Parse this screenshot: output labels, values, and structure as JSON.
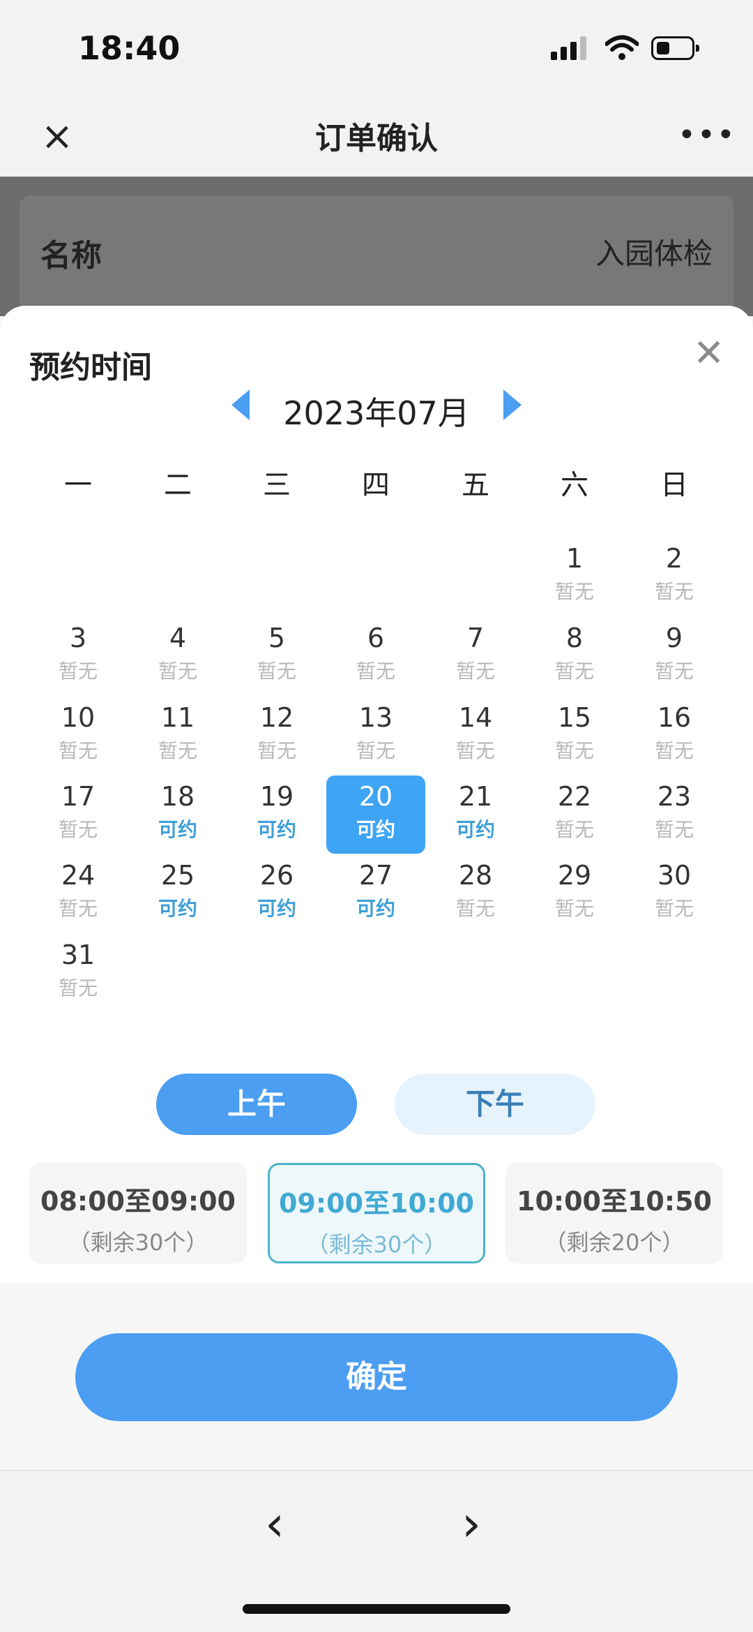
{
  "status": {
    "time": "18:40"
  },
  "header": {
    "title": "订单确认"
  },
  "background": {
    "name_label": "名称",
    "name_value": "入园体检"
  },
  "sheet": {
    "title": "预约时间",
    "month": "2023年07月"
  },
  "weekdays": [
    "一",
    "二",
    "三",
    "四",
    "五",
    "六",
    "日"
  ],
  "days": [
    {
      "num": "1",
      "status": "暂无",
      "avail": false
    },
    {
      "num": "2",
      "status": "暂无",
      "avail": false
    },
    {
      "num": "3",
      "status": "暂无",
      "avail": false
    },
    {
      "num": "4",
      "status": "暂无",
      "avail": false
    },
    {
      "num": "5",
      "status": "暂无",
      "avail": false
    },
    {
      "num": "6",
      "status": "暂无",
      "avail": false
    },
    {
      "num": "7",
      "status": "暂无",
      "avail": false
    },
    {
      "num": "8",
      "status": "暂无",
      "avail": false
    },
    {
      "num": "9",
      "status": "暂无",
      "avail": false
    },
    {
      "num": "10",
      "status": "暂无",
      "avail": false
    },
    {
      "num": "11",
      "status": "暂无",
      "avail": false
    },
    {
      "num": "12",
      "status": "暂无",
      "avail": false
    },
    {
      "num": "13",
      "status": "暂无",
      "avail": false
    },
    {
      "num": "14",
      "status": "暂无",
      "avail": false
    },
    {
      "num": "15",
      "status": "暂无",
      "avail": false
    },
    {
      "num": "16",
      "status": "暂无",
      "avail": false
    },
    {
      "num": "17",
      "status": "暂无",
      "avail": false
    },
    {
      "num": "18",
      "status": "可约",
      "avail": true
    },
    {
      "num": "19",
      "status": "可约",
      "avail": true
    },
    {
      "num": "20",
      "status": "可约",
      "avail": true,
      "selected": true
    },
    {
      "num": "21",
      "status": "可约",
      "avail": true
    },
    {
      "num": "22",
      "status": "暂无",
      "avail": false
    },
    {
      "num": "23",
      "status": "暂无",
      "avail": false
    },
    {
      "num": "24",
      "status": "暂无",
      "avail": false
    },
    {
      "num": "25",
      "status": "可约",
      "avail": true
    },
    {
      "num": "26",
      "status": "可约",
      "avail": true
    },
    {
      "num": "27",
      "status": "可约",
      "avail": true
    },
    {
      "num": "28",
      "status": "暂无",
      "avail": false
    },
    {
      "num": "29",
      "status": "暂无",
      "avail": false
    },
    {
      "num": "30",
      "status": "暂无",
      "avail": false
    },
    {
      "num": "31",
      "status": "暂无",
      "avail": false
    }
  ],
  "periods": {
    "am": "上午",
    "pm": "下午"
  },
  "slots": [
    {
      "time": "08:00至09:00",
      "remain": "（剩余30个）"
    },
    {
      "time": "09:00至10:00",
      "remain": "（剩余30个）",
      "selected": true
    },
    {
      "time": "10:00至10:50",
      "remain": "（剩余20个）"
    }
  ],
  "confirm_label": "确定",
  "colors": {
    "accent": "#4b9ef2",
    "available": "#3f9fd7",
    "unavailable": "#b8b8b8"
  }
}
